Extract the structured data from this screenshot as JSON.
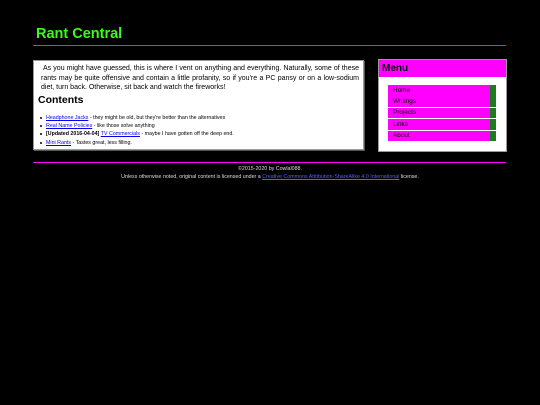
{
  "site": {
    "title": "Rant Central"
  },
  "main": {
    "intro": "As you might have guessed, this is where I vent on anything and everything. Naturally, some of these rants may be quite offensive and contain a little profanity, so if you're a PC pansy or on a low-sodium diet, turn back. Otherwise, sit back and watch the fireworks!",
    "contents_heading": "Contents",
    "toc": [
      {
        "prefix": "",
        "link": "Headphone Jacks",
        "desc": " - they might be old, but they're better than the alternatives"
      },
      {
        "prefix": "",
        "link": "Real Name Policies",
        "desc": " - like those solve anything"
      },
      {
        "prefix": "[Updated 2016-04-04] ",
        "link": "TV Commercials",
        "desc": " - maybe I have gotten off the deep end."
      },
      {
        "prefix": "",
        "link": "Mini Rants",
        "desc": " - Tastes great, less filling."
      }
    ]
  },
  "sidebar": {
    "title": "Menu",
    "items": [
      {
        "label": "Home"
      },
      {
        "label": "Writings"
      },
      {
        "label": "Projects"
      },
      {
        "label": "Links"
      },
      {
        "label": "About"
      }
    ]
  },
  "footer": {
    "copyright": "©2015-2020 by Cowlal088.",
    "license_prefix": "Unless otherwise noted, original content is licensed under a ",
    "license_link": "Creative Commons Attribution-ShareAlike 4.0 International",
    "license_suffix": " license."
  },
  "colors": {
    "accent": "#ff00ff",
    "title": "#39ff14",
    "menu_edge": "#1e7a1e"
  }
}
